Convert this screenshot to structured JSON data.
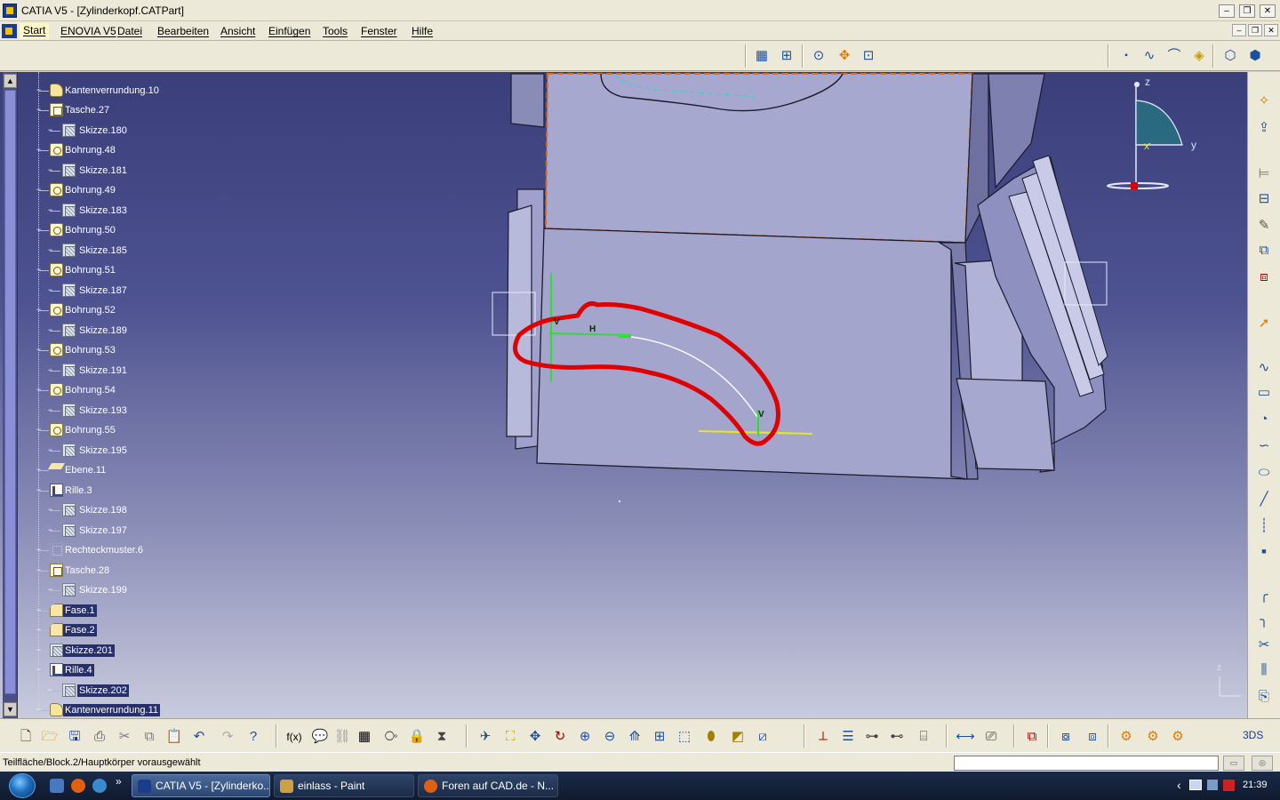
{
  "window": {
    "title": "CATIA V5 - [Zylinderkopf.CATPart]",
    "buttons": {
      "minimize": "‒",
      "restore": "❐",
      "close": "✕"
    }
  },
  "menu": {
    "items": [
      "Start",
      "ENOVIA V5",
      "Datei",
      "Bearbeiten",
      "Ansicht",
      "Einfügen",
      "Tools",
      "Fenster",
      "Hilfe"
    ],
    "doc_buttons": {
      "minimize": "‒",
      "restore": "❐",
      "close": "✕"
    }
  },
  "tree": {
    "items": [
      {
        "label": "Kantenverrundung.10",
        "icon": "fillet-icon"
      },
      {
        "label": "Tasche.27",
        "icon": "pocket-icon"
      },
      {
        "label": "Skizze.180",
        "icon": "sketch-icon"
      },
      {
        "label": "Bohrung.48",
        "icon": "hole-icon"
      },
      {
        "label": "Skizze.181",
        "icon": "sketch-icon"
      },
      {
        "label": "Bohrung.49",
        "icon": "hole-icon"
      },
      {
        "label": "Skizze.183",
        "icon": "sketch-icon"
      },
      {
        "label": "Bohrung.50",
        "icon": "hole-icon"
      },
      {
        "label": "Skizze.185",
        "icon": "sketch-icon"
      },
      {
        "label": "Bohrung.51",
        "icon": "hole-icon"
      },
      {
        "label": "Skizze.187",
        "icon": "sketch-icon"
      },
      {
        "label": "Bohrung.52",
        "icon": "hole-icon"
      },
      {
        "label": "Skizze.189",
        "icon": "sketch-icon"
      },
      {
        "label": "Bohrung.53",
        "icon": "hole-icon"
      },
      {
        "label": "Skizze.191",
        "icon": "sketch-icon"
      },
      {
        "label": "Bohrung.54",
        "icon": "hole-icon"
      },
      {
        "label": "Skizze.193",
        "icon": "sketch-icon"
      },
      {
        "label": "Bohrung.55",
        "icon": "hole-icon"
      },
      {
        "label": "Skizze.195",
        "icon": "sketch-icon"
      },
      {
        "label": "Ebene.11",
        "icon": "plane-icon"
      },
      {
        "label": "Rille.3",
        "icon": "groove-icon"
      },
      {
        "label": "Skizze.198",
        "icon": "sketch-icon"
      },
      {
        "label": "Skizze.197",
        "icon": "sketch-icon"
      },
      {
        "label": "Rechteckmuster.6",
        "icon": "pattern-icon"
      },
      {
        "label": "Tasche.28",
        "icon": "pocket-icon"
      },
      {
        "label": "Skizze.199",
        "icon": "sketch-icon"
      },
      {
        "label": "Fase.1",
        "icon": "chamfer-icon"
      },
      {
        "label": "Fase.2",
        "icon": "chamfer-icon"
      },
      {
        "label": "Skizze.201",
        "icon": "sketch-icon"
      },
      {
        "label": "Rille.4",
        "icon": "groove-icon"
      },
      {
        "label": "Skizze.202",
        "icon": "sketch-icon"
      },
      {
        "label": "Kantenverrundung.11",
        "icon": "fillet-icon"
      }
    ]
  },
  "compass": {
    "z": "z",
    "y": "y",
    "x": "x"
  },
  "mini_axis": {
    "z": "z"
  },
  "sketch_labels": {
    "v1": "V",
    "h": "H",
    "v2": "V"
  },
  "statusbar": {
    "text": "Teilfläche/Block.2/Hauptkörper vorausgewählt",
    "command_value": ""
  },
  "taskbar": {
    "tasks": [
      {
        "label": "CATIA V5 - [Zylinderko...",
        "icon": "catia-icon"
      },
      {
        "label": "einlass - Paint",
        "icon": "paint-icon"
      },
      {
        "label": "Foren auf CAD.de - N...",
        "icon": "firefox-icon"
      }
    ],
    "overflow": "»",
    "tray_arrow": "‹",
    "clock": "21:39"
  },
  "colors": {
    "viewport_top": "#3a3f7a",
    "viewport_bottom": "#c9cbde",
    "part_face": "#a4a5cc",
    "highlight_orange": "#e06a1a",
    "sketch_green": "#2ee02e",
    "annotation_red": "#e00000",
    "tree_selected": "#27306b"
  }
}
